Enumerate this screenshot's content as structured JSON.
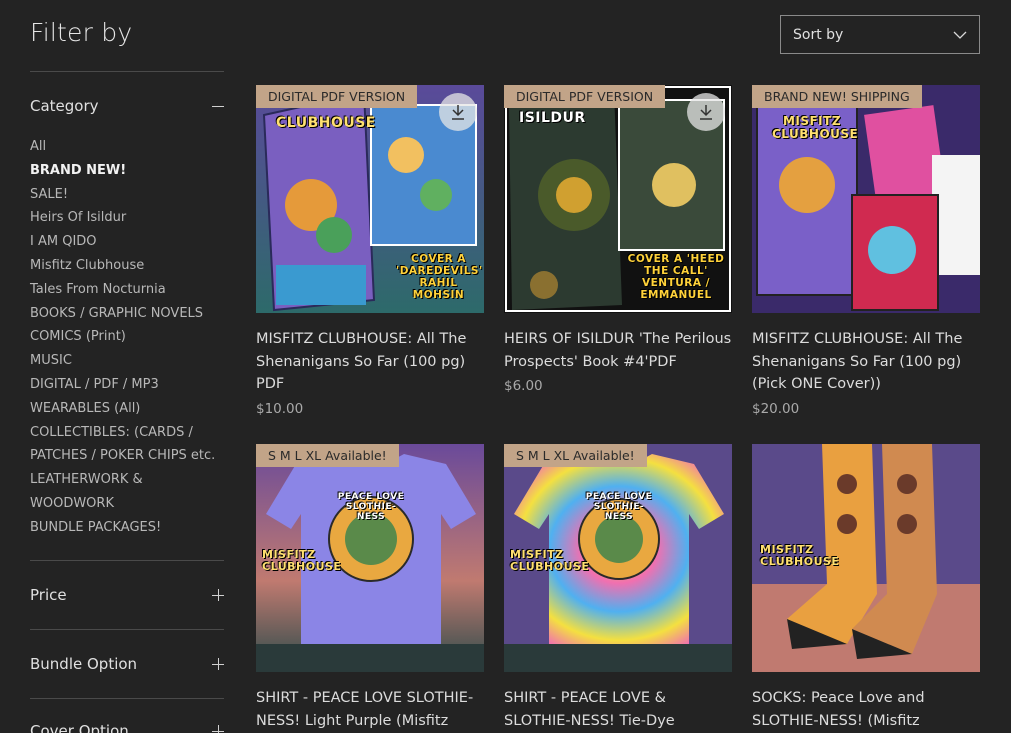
{
  "sidebar": {
    "title": "Filter by",
    "category_label": "Category",
    "categories": [
      "All",
      "BRAND NEW!",
      "SALE!",
      "Heirs Of Isildur",
      "I AM QIDO",
      "Misfitz Clubhouse",
      "Tales From Nocturnia",
      "BOOKS / GRAPHIC NOVELS",
      "COMICS (Print)",
      "MUSIC",
      "DIGITAL / PDF / MP3",
      "WEARABLES (All)",
      "COLLECTIBLES: (CARDS /",
      "PATCHES / POKER CHIPS etc.",
      "LEATHERWORK &",
      "WOODWORK",
      "BUNDLE PACKAGES!"
    ],
    "active_category": "BRAND NEW!",
    "filters": [
      "Price",
      "Bundle Option",
      "Cover Option"
    ]
  },
  "sort": {
    "label": "Sort by"
  },
  "products": [
    {
      "ribbon": "DIGITAL PDF VERSION",
      "name": "MISFITZ CLUBHOUSE: All The Shenanigans So Far (100 pg) PDF",
      "price": "$10.00",
      "cover_top": "CLUBHOUSE",
      "cover_caption": "COVER A 'DAREDEVILS' RAHIL MOHSIN"
    },
    {
      "ribbon": "DIGITAL PDF VERSION",
      "name": "HEIRS OF ISILDUR 'The Perilous Prospects' Book #4'PDF",
      "price": "$6.00",
      "cover_top": "ISILDUR",
      "cover_caption": "COVER A 'HEED THE CALL' VENTURA / EMMANUEL"
    },
    {
      "ribbon": "BRAND NEW! SHIPPING",
      "name": "MISFITZ CLUBHOUSE: All The Shenanigans So Far (100 pg) (Pick ONE Cover))",
      "price": "$20.00",
      "cover_top": "MISFITZ CLUBHOUSE",
      "cover_caption": ""
    },
    {
      "ribbon": "S M L XL Available!",
      "name": "SHIRT - PEACE LOVE SLOTHIE-NESS! Light Purple (Misfitz",
      "price": "",
      "cover_top": "PEACE LOVE SLOTHIE-NESS",
      "cover_caption": "MISFITZ CLUBHOUSE"
    },
    {
      "ribbon": "S M L XL Available!",
      "name": "SHIRT - PEACE LOVE & SLOTHIE-NESS! Tie-Dye",
      "price": "",
      "cover_top": "PEACE LOVE SLOTHIE-NESS",
      "cover_caption": "MISFITZ CLUBHOUSE"
    },
    {
      "ribbon": "",
      "name": "SOCKS: Peace Love and SLOTHIE-NESS! (Misfitz",
      "price": "",
      "cover_top": "",
      "cover_caption": "MISFITZ CLUBHOUSE"
    }
  ],
  "colors": {
    "background": "#232323",
    "ribbon": "#c2a488",
    "divider": "#4a4a4a"
  },
  "icons": {
    "sort": "chevron-down-icon",
    "download": "download-icon",
    "collapse": "minus-icon",
    "expand": "plus-icon"
  }
}
